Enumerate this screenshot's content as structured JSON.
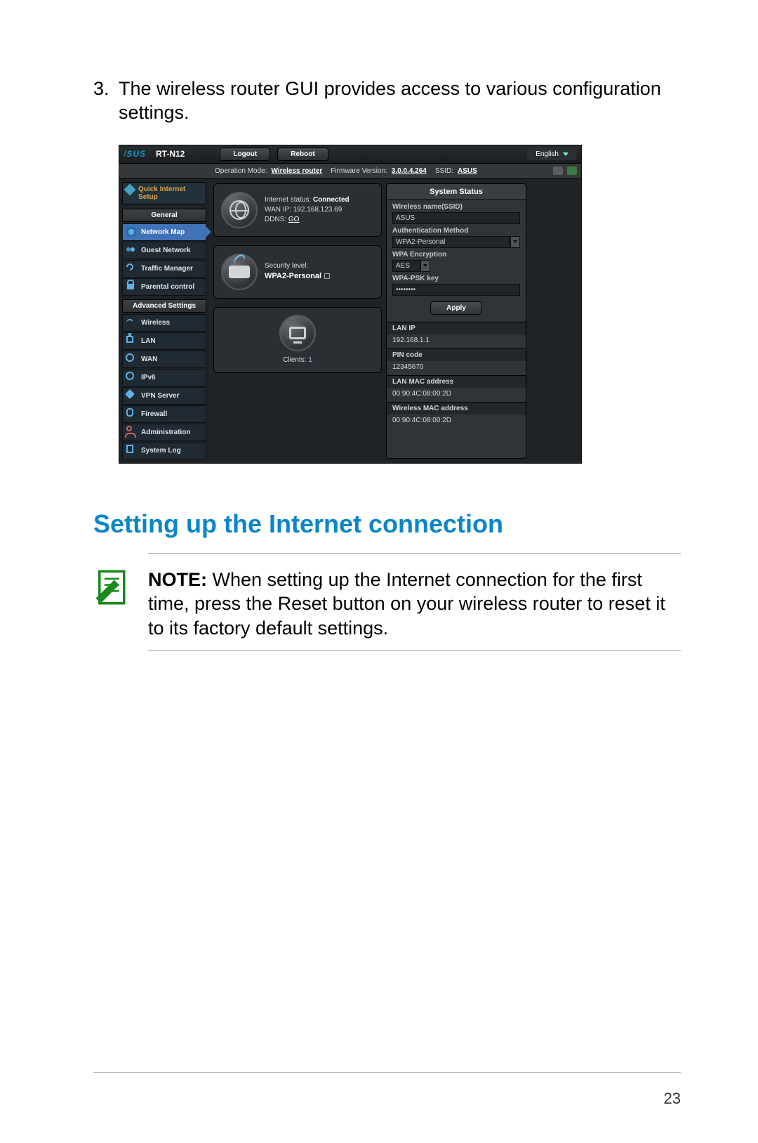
{
  "step": {
    "num": "3.",
    "text": "The wireless router GUI provides access to various configuration settings."
  },
  "gui": {
    "brand": "/SUS",
    "model": "RT-N12",
    "top_buttons": {
      "logout": "Logout",
      "reboot": "Reboot"
    },
    "language": "English",
    "subbar": {
      "op_mode_label": "Operation Mode:",
      "op_mode_value": "Wireless router",
      "fw_label": "Firmware Version:",
      "fw_value": "3.0.0.4.264",
      "ssid_label": "SSID:",
      "ssid_value": "ASUS"
    },
    "sidebar": {
      "qis": "Quick Internet Setup",
      "general_header": "General",
      "general": [
        "Network Map",
        "Guest Network",
        "Traffic Manager",
        "Parental control"
      ],
      "advanced_header": "Advanced Settings",
      "advanced": [
        "Wireless",
        "LAN",
        "WAN",
        "IPv6",
        "VPN Server",
        "Firewall",
        "Administration",
        "System Log"
      ]
    },
    "cards": {
      "internet": {
        "status_label": "Internet status:",
        "status_value": "Connected",
        "wanip_label": "WAN IP:",
        "wanip_value": "192.168.123.69",
        "ddns_label": "DDNS:",
        "ddns_value": "GO"
      },
      "security": {
        "label": "Security level:",
        "value": "WPA2-Personal"
      },
      "clients": {
        "label": "Clients:",
        "count": "1"
      }
    },
    "status": {
      "title": "System Status",
      "wname_label": "Wireless name(SSID)",
      "wname_value": "ASUS",
      "auth_label": "Authentication Method",
      "auth_value": "WPA2-Personal",
      "enc_label": "WPA Encryption",
      "enc_value": "AES",
      "psk_label": "WPA-PSK key",
      "psk_value": "••••••••",
      "apply": "Apply",
      "lanip_label": "LAN IP",
      "lanip_value": "192.168.1.1",
      "pin_label": "PIN code",
      "pin_value": "12345670",
      "lanmac_label": "LAN MAC address",
      "lanmac_value": "00:90:4C:08:00:2D",
      "wmac_label": "Wireless MAC address",
      "wmac_value": "00:90:4C:08:00:2D"
    }
  },
  "section_heading": "Setting up the Internet connection",
  "note": {
    "prefix": "NOTE:",
    "body": " When setting up the Internet connection for the first time, press the Reset button on your wireless router to reset it to its factory default settings."
  },
  "page_number": "23"
}
